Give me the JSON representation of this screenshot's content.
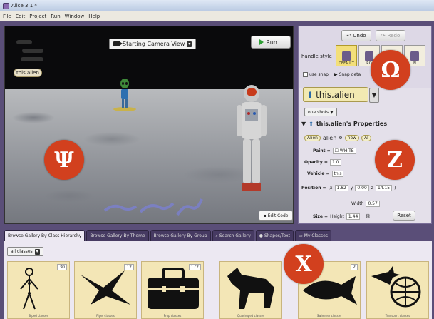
{
  "window": {
    "title": "Alice 3.1 *"
  },
  "menu": [
    "File",
    "Edit",
    "Project",
    "Run",
    "Window",
    "Help"
  ],
  "scene": {
    "camera_view_label": "Starting Camera View",
    "run_label": "Run...",
    "selected_tag": "this.alien",
    "edit_code_label": "Edit Code"
  },
  "handles": {
    "undo_label": "Undo",
    "redo_label": "Redo",
    "handle_style_label": "handle style",
    "styles": [
      "DEFAULT",
      "RO",
      "",
      "N"
    ],
    "use_snap_label": "use snap",
    "snap_details_label": "Snap deta"
  },
  "properties": {
    "selector_value": "this.alien",
    "one_shots_label": "one shots",
    "header": "this.alien's Properties",
    "class_pill": "Alien",
    "name": "alien",
    "new_label": "new",
    "new_pill": "Al",
    "paint_label": "Paint =",
    "paint_value": "WHITE",
    "opacity_label": "Opacity =",
    "opacity_value": "1.0",
    "vehicle_label": "Vehicle =",
    "vehicle_value": "this",
    "position_label": "Position =",
    "pos_open": "(x",
    "pos_x": "1.82",
    "pos_y_label": "y",
    "pos_y": "0.00",
    "pos_z_label": "z",
    "pos_z": "14.15",
    "pos_close": ")",
    "width_label": "Width",
    "width_value": "0.57",
    "size_label": "Size =",
    "height_label": "Height",
    "height_value": "1.44",
    "reset_label": "Reset"
  },
  "gallery": {
    "tabs": [
      "Browse Gallery By Class Hierarchy",
      "Browse Gallery By Theme",
      "Browse Gallery By Group",
      "Search Gallery",
      "Shapes/Text",
      "My Classes"
    ],
    "filter_value": "all classes",
    "tiles": [
      {
        "name": "Biped classes",
        "count": "30"
      },
      {
        "name": "Flyer classes",
        "count": "12"
      },
      {
        "name": "Prop classes",
        "count": "172"
      },
      {
        "name": "Quadruped classes",
        "count": ""
      },
      {
        "name": "Swimmer classes",
        "count": "2"
      },
      {
        "name": "Transport classes",
        "count": ""
      }
    ]
  },
  "badges": {
    "psi": "Ψ",
    "omega": "Ω",
    "zeta": "Z",
    "chi": "X"
  },
  "colors": {
    "badge": "#d2401e",
    "chrome": "#5a4e78",
    "selector": "#f2e9b2"
  }
}
